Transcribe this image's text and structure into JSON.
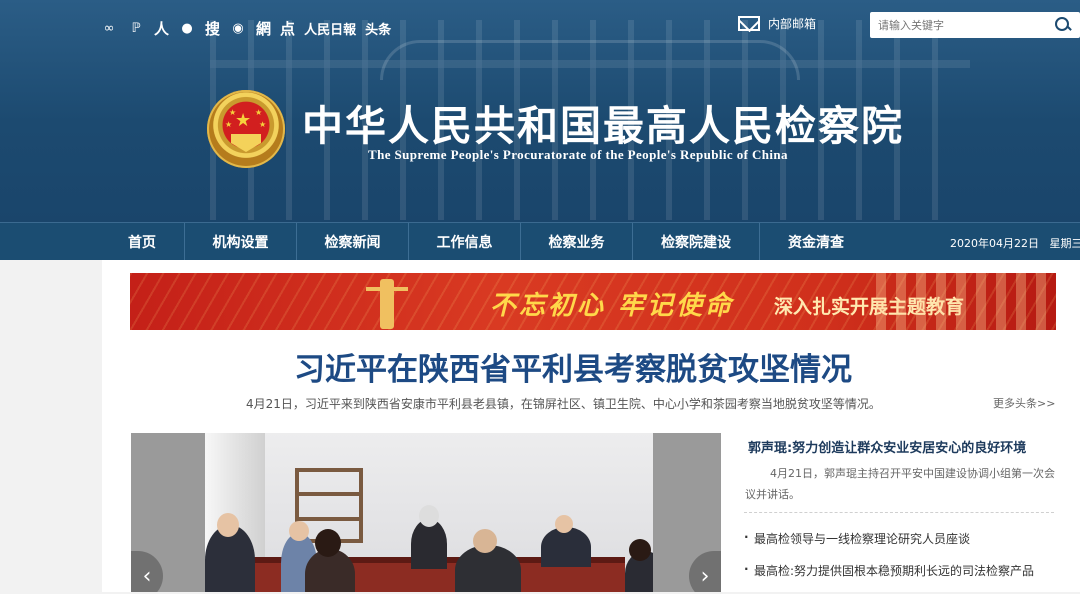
{
  "header": {
    "social": [
      {
        "icon": "weibo-icon",
        "glyph": "∞"
      },
      {
        "icon": "people-daily-icon",
        "glyph": "ℙ"
      },
      {
        "label": "人"
      },
      {
        "icon": "wechat-icon",
        "glyph": "●"
      },
      {
        "label": "搜"
      },
      {
        "icon": "netease-icon",
        "glyph": "◉"
      },
      {
        "label": "網"
      },
      {
        "label": "点"
      },
      {
        "label": "人民日報"
      },
      {
        "label": "头条"
      }
    ],
    "mail_label": "内部邮箱",
    "search_placeholder": "请输入关键字",
    "title": "中华人民共和国最高人民检察院",
    "subtitle": "The Supreme People's Procuratorate of the People's Republic of China"
  },
  "nav": {
    "items": [
      "首页",
      "机构设置",
      "检察新闻",
      "工作信息",
      "检察业务",
      "检察院建设",
      "资金清查"
    ],
    "date": "2020年04月22日",
    "weekday": "星期三"
  },
  "banner": {
    "slogan": "不忘初心 牢记使命",
    "subtitle": "深入扎实开展主题教育"
  },
  "headline": {
    "title": "习近平在陕西省平利县考察脱贫攻坚情况",
    "summary": "4月21日，习近平来到陕西省安康市平利县老县镇，在锦屏社区、镇卫生院、中心小学和茶园考察当地脱贫攻坚等情况。",
    "more": "更多头条>>"
  },
  "carousel": {
    "prev": "‹",
    "next": "›"
  },
  "side_news": {
    "title": "郭声琨:努力创造让群众安业安居安心的良好环境",
    "desc": "4月21日，郭声琨主持召开平安中国建设协调小组第一次会议并讲话。",
    "list": [
      "最高检领导与一线检察理论研究人员座谈",
      "最高检:努力提供固根本稳预期利长远的司法检察产品"
    ]
  },
  "colors": {
    "header": "#1c4a70",
    "nav": "#1b4d72",
    "headline": "#1d4a84",
    "banner": "#c42018"
  }
}
